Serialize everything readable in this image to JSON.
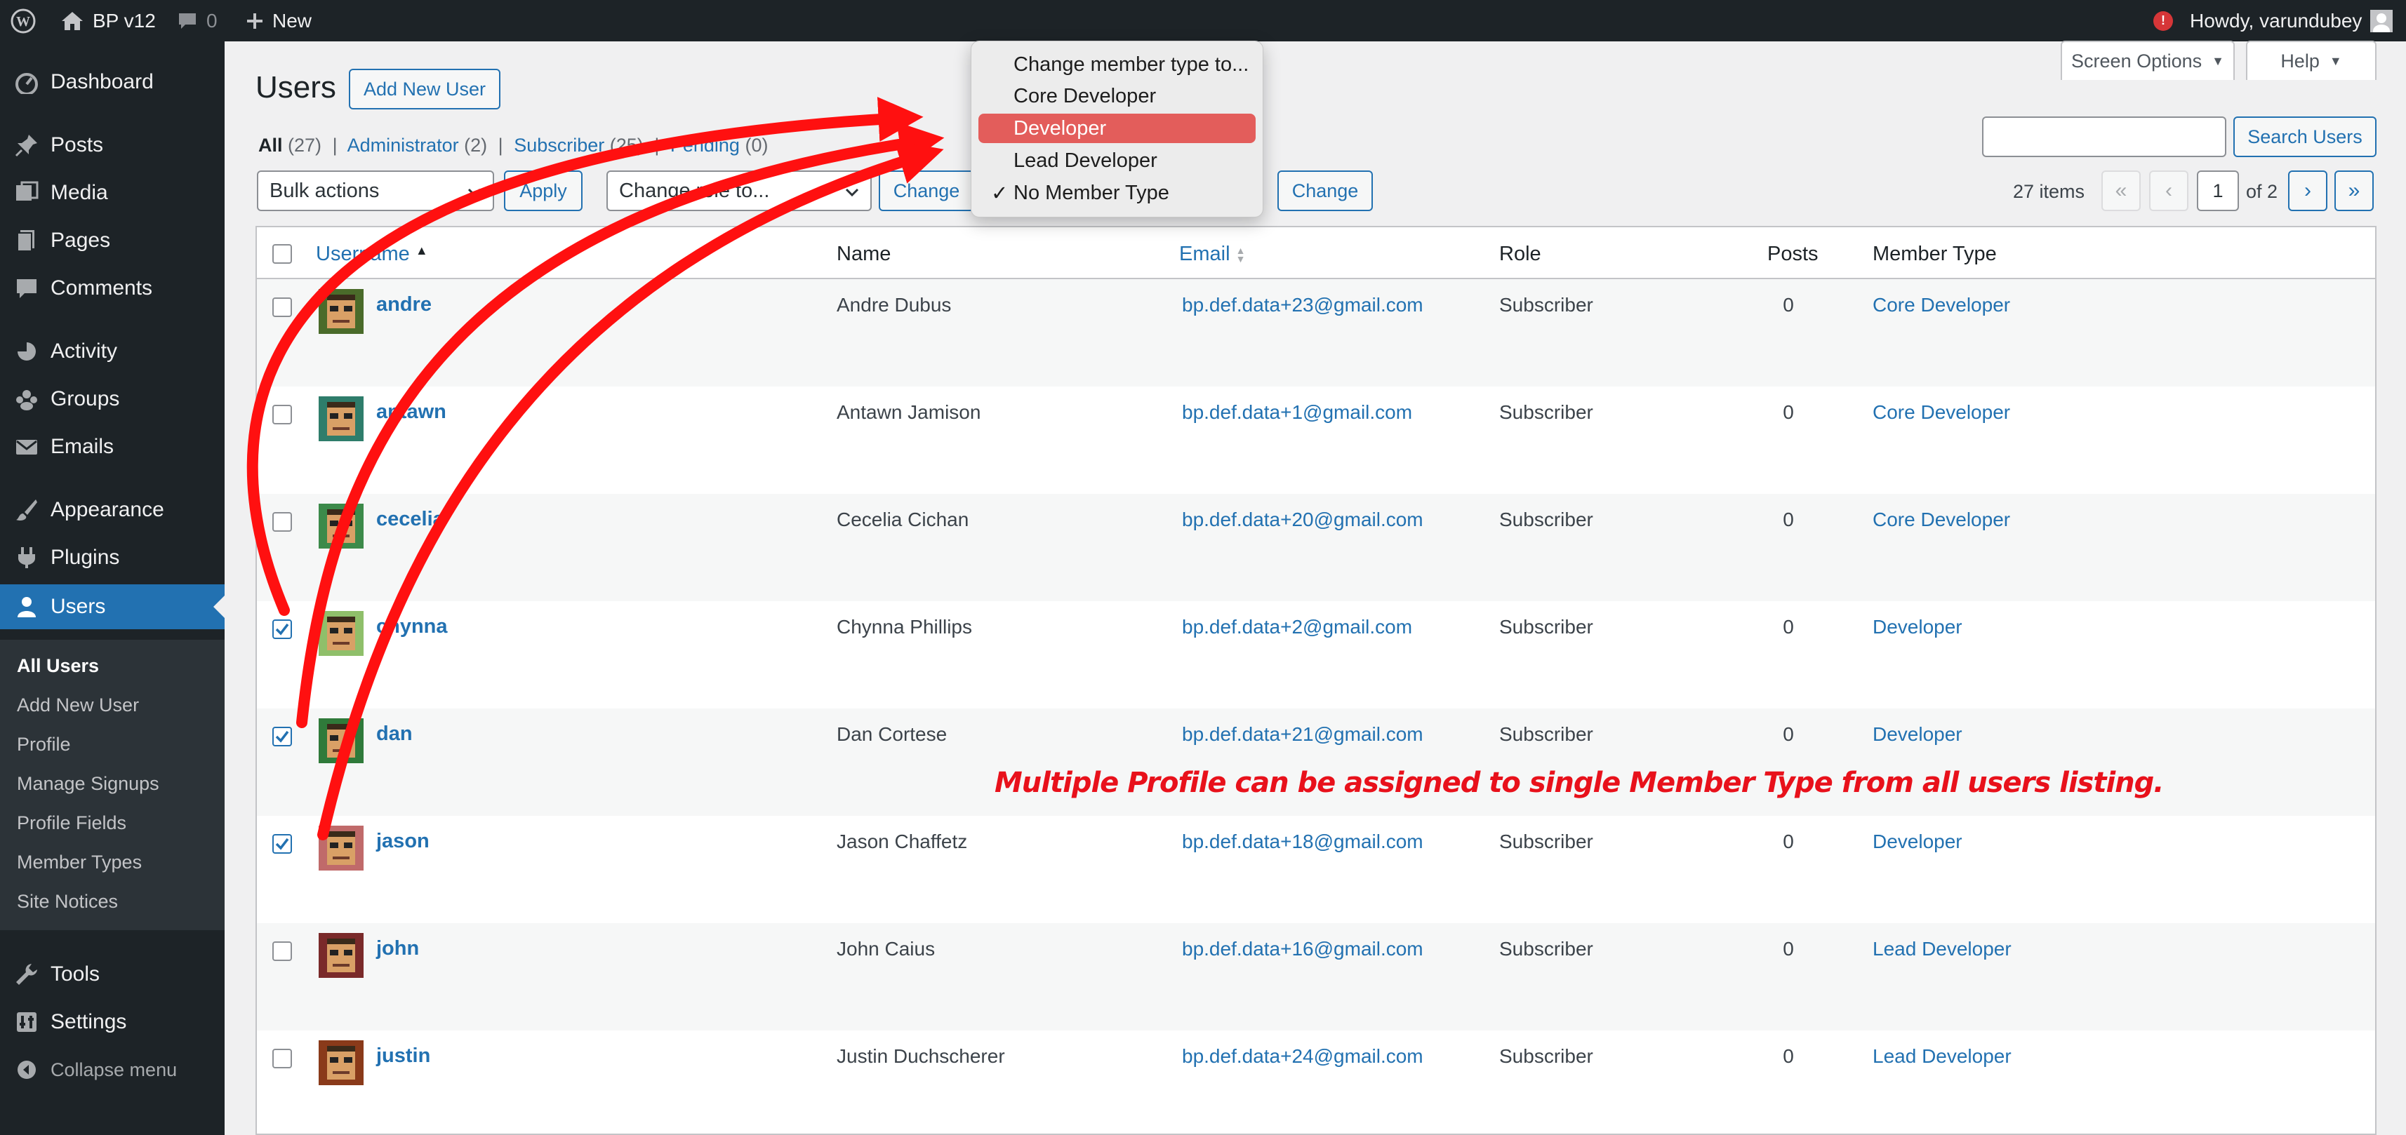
{
  "admin_bar": {
    "site_name": "BP v12",
    "comments_count": "0",
    "new_label": "New",
    "greeting": "Howdy, varundubey",
    "notification_badge": "!"
  },
  "sidebar": {
    "items": [
      {
        "label": "Dashboard",
        "icon": "dashboard-icon"
      },
      {
        "label": "Posts",
        "icon": "pin-icon"
      },
      {
        "label": "Media",
        "icon": "media-icon"
      },
      {
        "label": "Pages",
        "icon": "pages-icon"
      },
      {
        "label": "Comments",
        "icon": "comment-icon"
      },
      {
        "label": "Activity",
        "icon": "activity-icon"
      },
      {
        "label": "Groups",
        "icon": "groups-icon"
      },
      {
        "label": "Emails",
        "icon": "email-icon"
      },
      {
        "label": "Appearance",
        "icon": "brush-icon"
      },
      {
        "label": "Plugins",
        "icon": "plugin-icon"
      },
      {
        "label": "Users",
        "icon": "user-icon"
      },
      {
        "label": "Tools",
        "icon": "wrench-icon"
      },
      {
        "label": "Settings",
        "icon": "settings-icon"
      },
      {
        "label": "Collapse menu",
        "icon": "collapse-icon"
      }
    ],
    "submenu": [
      "All Users",
      "Add New User",
      "Profile",
      "Manage Signups",
      "Profile Fields",
      "Member Types",
      "Site Notices"
    ]
  },
  "header": {
    "title": "Users",
    "add_new": "Add New User",
    "screen_options": "Screen Options",
    "help": "Help"
  },
  "filters": {
    "all": "All",
    "all_count": "(27)",
    "admin": "Administrator",
    "admin_count": "(2)",
    "subscriber": "Subscriber",
    "subscriber_count": "(25)",
    "pending": "Pending",
    "pending_count": "(0)"
  },
  "actions": {
    "bulk": "Bulk actions",
    "apply": "Apply",
    "change_role": "Change role to...",
    "change1": "Change",
    "change2": "Change",
    "search_button": "Search Users",
    "search_value": ""
  },
  "pagination": {
    "items": "27 items",
    "first": "«",
    "prev": "‹",
    "current": "1",
    "of": "of 2",
    "next": "›",
    "last": "»"
  },
  "table": {
    "columns": [
      "Username",
      "Name",
      "Email",
      "Role",
      "Posts",
      "Member Type"
    ],
    "rows": [
      {
        "username": "andre",
        "name": "Andre Dubus",
        "email": "bp.def.data+23@gmail.com",
        "role": "Subscriber",
        "posts": "0",
        "member_type": "Core Developer",
        "checked": false,
        "avatar_color": "#4a6b2a"
      },
      {
        "username": "antawn",
        "name": "Antawn Jamison",
        "email": "bp.def.data+1@gmail.com",
        "role": "Subscriber",
        "posts": "0",
        "member_type": "Core Developer",
        "checked": false,
        "avatar_color": "#2e7d6b"
      },
      {
        "username": "cecelia",
        "name": "Cecelia Cichan",
        "email": "bp.def.data+20@gmail.com",
        "role": "Subscriber",
        "posts": "0",
        "member_type": "Core Developer",
        "checked": false,
        "avatar_color": "#3c8a4a"
      },
      {
        "username": "chynna",
        "name": "Chynna Phillips",
        "email": "bp.def.data+2@gmail.com",
        "role": "Subscriber",
        "posts": "0",
        "member_type": "Developer",
        "checked": true,
        "avatar_color": "#8fbf6a"
      },
      {
        "username": "dan",
        "name": "Dan Cortese",
        "email": "bp.def.data+21@gmail.com",
        "role": "Subscriber",
        "posts": "0",
        "member_type": "Developer",
        "checked": true,
        "avatar_color": "#2f7a3a"
      },
      {
        "username": "jason",
        "name": "Jason Chaffetz",
        "email": "bp.def.data+18@gmail.com",
        "role": "Subscriber",
        "posts": "0",
        "member_type": "Developer",
        "checked": true,
        "avatar_color": "#c06a6a"
      },
      {
        "username": "john",
        "name": "John Caius",
        "email": "bp.def.data+16@gmail.com",
        "role": "Subscriber",
        "posts": "0",
        "member_type": "Lead Developer",
        "checked": false,
        "avatar_color": "#7a2a2a"
      },
      {
        "username": "justin",
        "name": "Justin Duchscherer",
        "email": "bp.def.data+24@gmail.com",
        "role": "Subscriber",
        "posts": "0",
        "member_type": "Lead Developer",
        "checked": false,
        "avatar_color": "#8a3a1a"
      }
    ]
  },
  "dropdown": {
    "options": [
      "Change member type to...",
      "Core Developer",
      "Developer",
      "Lead Developer",
      "No Member Type"
    ],
    "highlighted": "Developer",
    "checked": "No Member Type",
    "highlight_color": "#e35d5b"
  },
  "annotation": {
    "text": "Multiple Profile can be assigned to single Member Type from all users listing.",
    "color": "#e8111b"
  }
}
